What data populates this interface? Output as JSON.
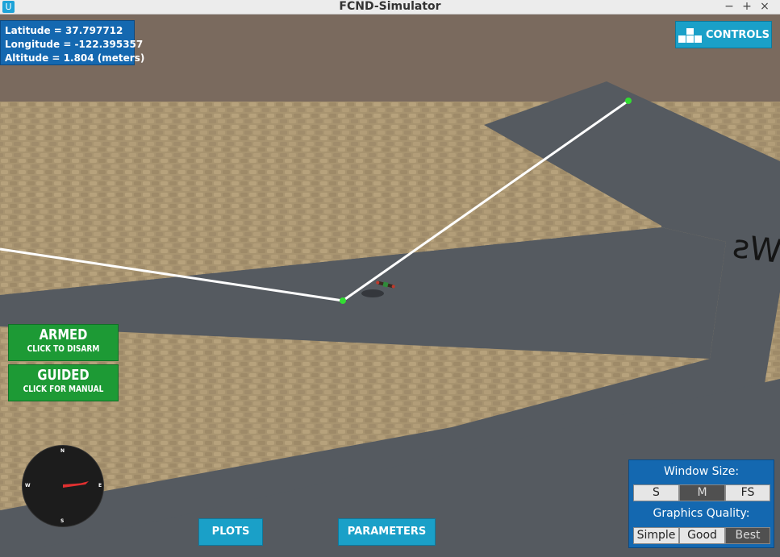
{
  "window": {
    "title": "FCND-Simulator",
    "app_icon": "unity-icon",
    "minimize": "−",
    "maximize": "+",
    "close": "×"
  },
  "info": {
    "latitude": "Latitude = 37.797712",
    "longitude": "Longitude = -122.395357",
    "altitude": "Altitude = 1.804 (meters)"
  },
  "controls": {
    "label": "CONTROLS",
    "icon": "controls-blocks-icon"
  },
  "armed": {
    "title": "ARMED",
    "subtitle": "CLICK TO DISARM",
    "color": "#1d9a35"
  },
  "guided": {
    "title": "GUIDED",
    "subtitle": "CLICK FOR MANUAL",
    "color": "#1d9a35"
  },
  "compass": {
    "n": "N",
    "e": "E",
    "s": "S",
    "w": "W"
  },
  "bottom": {
    "plots": "PLOTS",
    "parameters": "PARAMETERS"
  },
  "window_size": {
    "title": "Window Size:",
    "options": [
      "S",
      "M",
      "FS"
    ],
    "selected": "M"
  },
  "graphics_quality": {
    "title": "Graphics Quality:",
    "options": [
      "Simple",
      "Good",
      "Best"
    ],
    "selected": "Best"
  },
  "scene": {
    "ground_text": "Ws",
    "colors": {
      "sky": "#7a6a5e",
      "ground": "#a89470",
      "road": "#555a60",
      "path": "#ffffff",
      "waypoint": "#33dd33",
      "accent": "#1aa0c8",
      "panel": "#1468b0"
    }
  }
}
